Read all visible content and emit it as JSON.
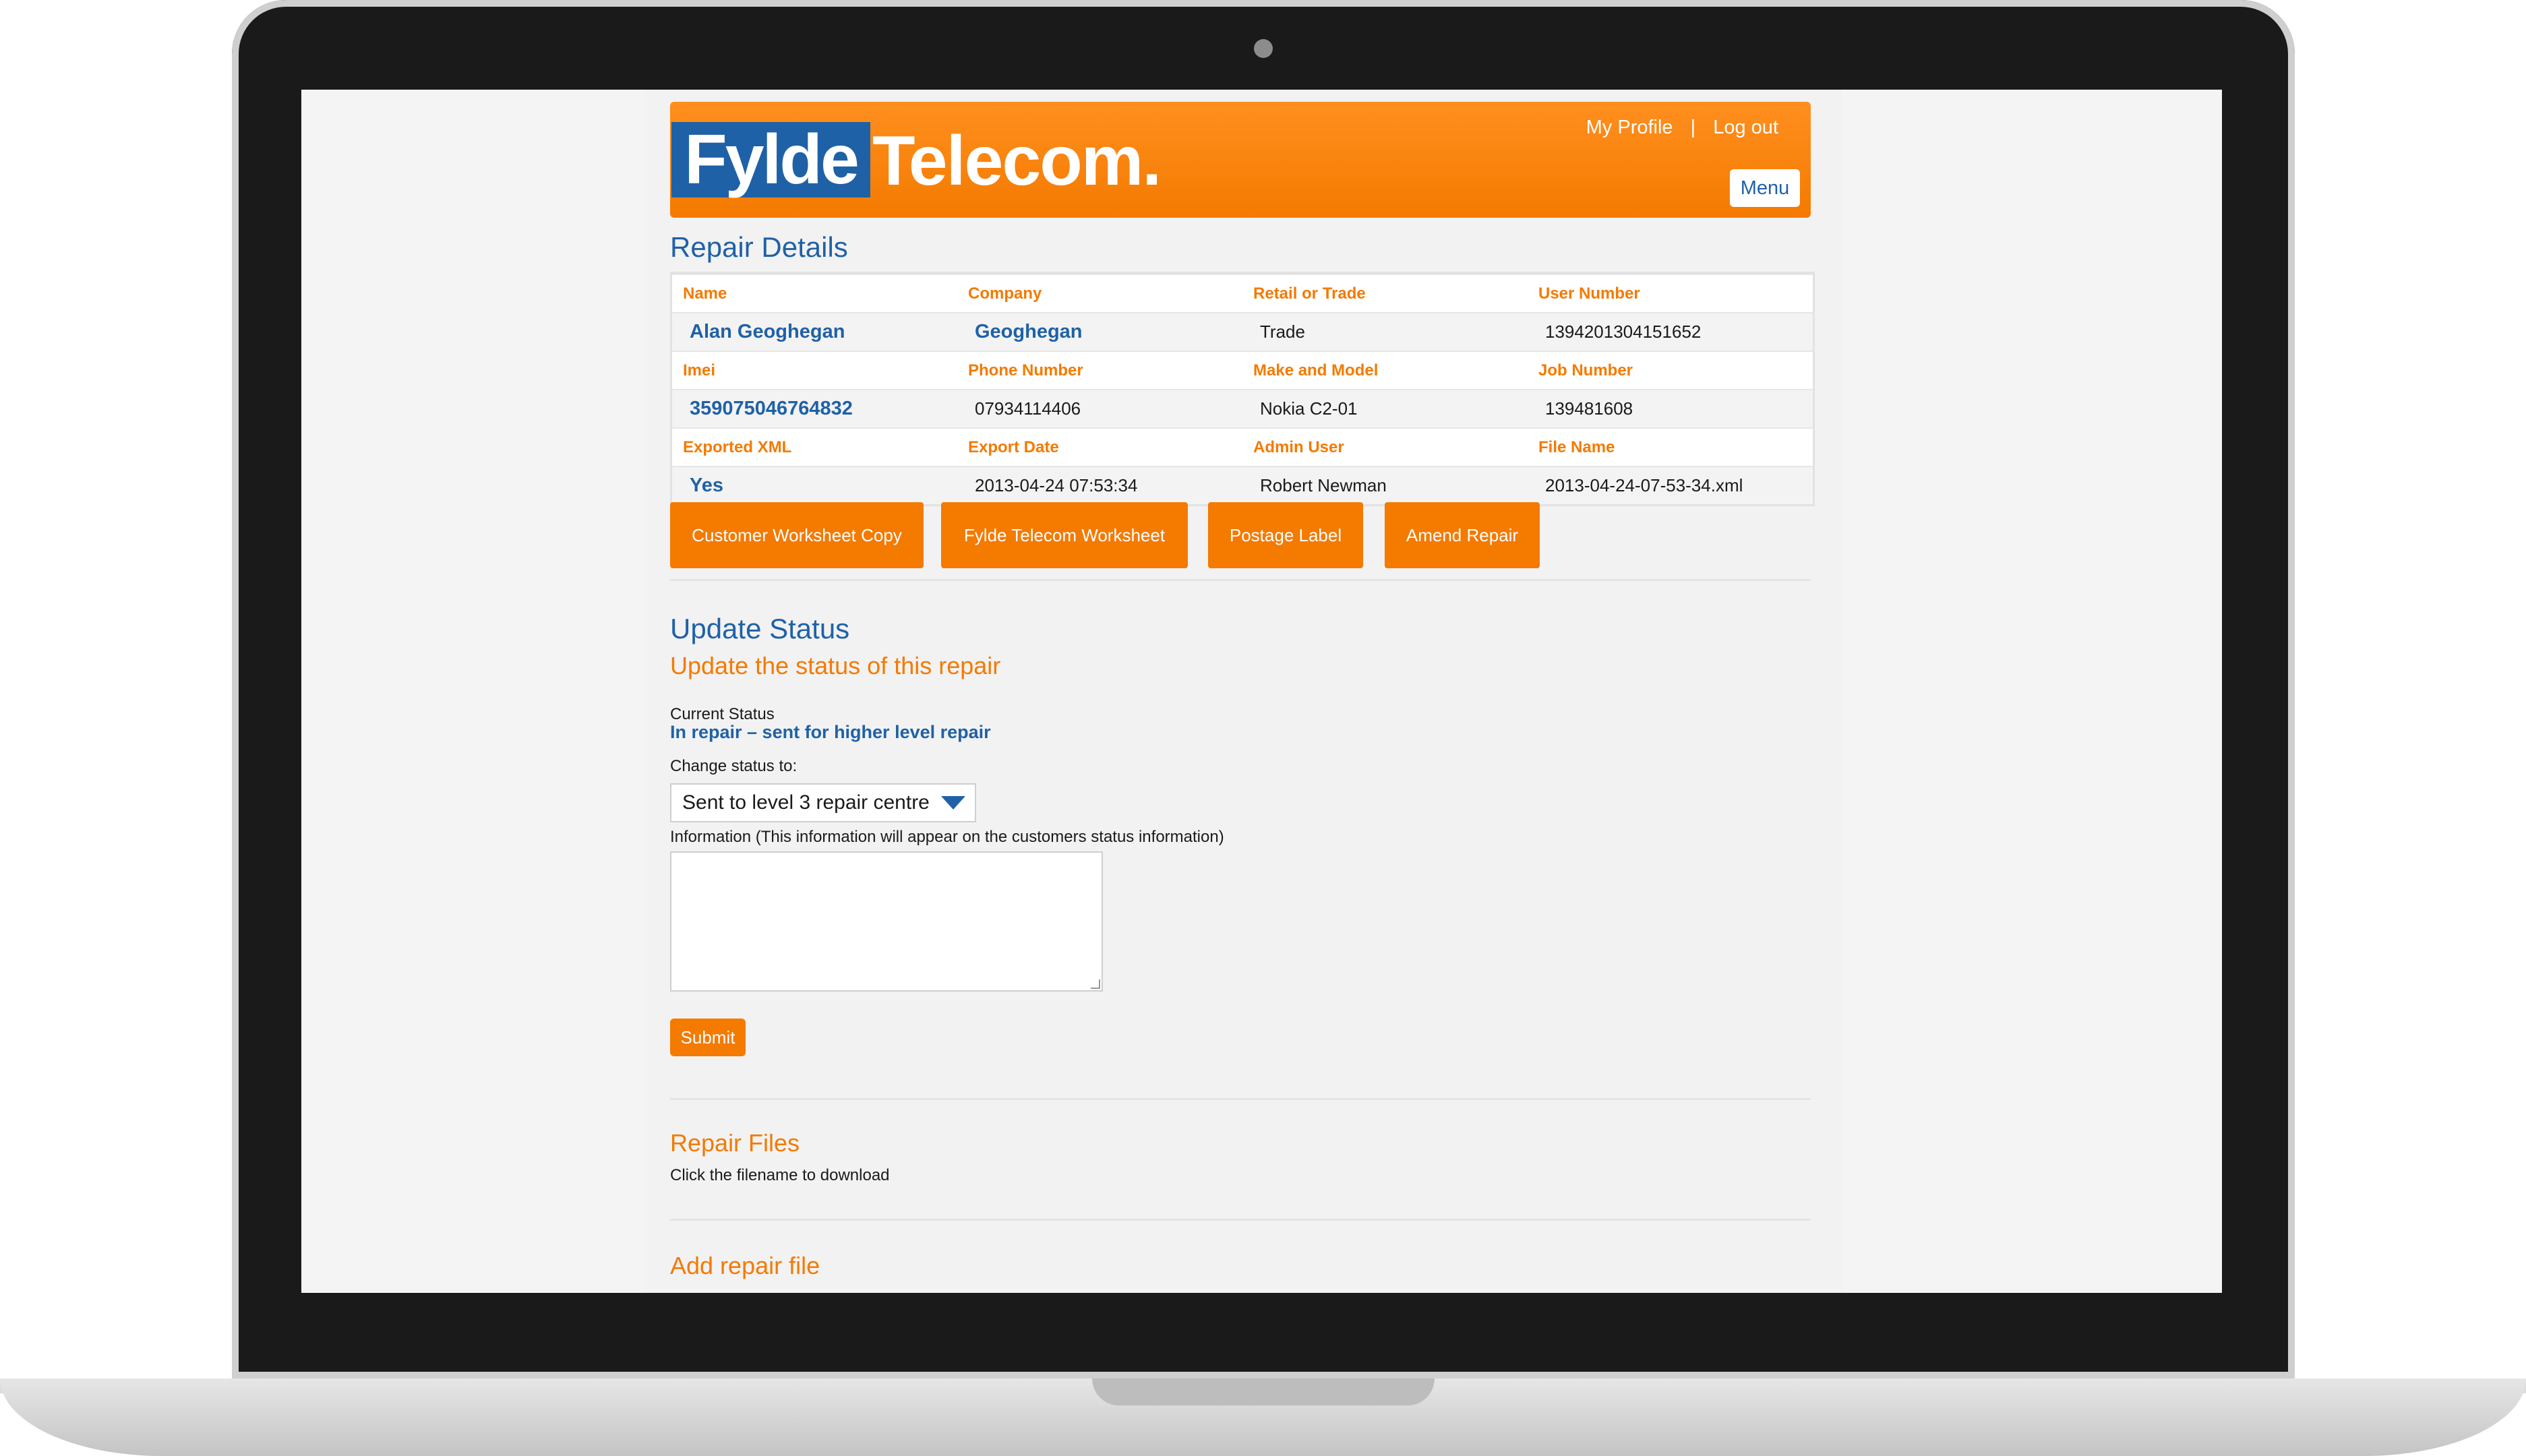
{
  "header": {
    "logo_left": "Fylde",
    "logo_right": "Telecom.",
    "my_profile": "My Profile",
    "separator": "|",
    "log_out": "Log out",
    "menu": "Menu"
  },
  "repair_details": {
    "title": "Repair Details",
    "rows": [
      {
        "labels": [
          "Name",
          "Company",
          "Retail or Trade",
          "User Number"
        ],
        "values": [
          "Alan Geoghegan",
          "Geoghegan",
          "Trade",
          "1394201304151652"
        ]
      },
      {
        "labels": [
          "Imei",
          "Phone Number",
          "Make and Model",
          "Job Number"
        ],
        "values": [
          "359075046764832",
          "07934114406",
          "Nokia C2-01",
          "139481608"
        ]
      },
      {
        "labels": [
          "Exported XML",
          "Export Date",
          "Admin User",
          "File Name"
        ],
        "values": [
          "Yes",
          "2013-04-24 07:53:34",
          "Robert Newman",
          "2013-04-24-07-53-34.xml"
        ]
      }
    ]
  },
  "actions": {
    "customer_worksheet": "Customer Worksheet Copy",
    "fylde_worksheet": "Fylde Telecom Worksheet",
    "postage_label": "Postage Label",
    "amend_repair": "Amend Repair"
  },
  "update_status": {
    "title": "Update Status",
    "subtitle": "Update the status of this repair",
    "current_label": "Current Status",
    "current_value": "In repair – sent for higher level repair",
    "change_label": "Change status to:",
    "selected_option": "Sent to level 3 repair centre",
    "info_label": "Information (This information will appear on the customers status information)",
    "info_value": "",
    "submit": "Submit"
  },
  "repair_files": {
    "title": "Repair Files",
    "hint": "Click the filename to download"
  },
  "add_repair_file": {
    "title": "Add repair file"
  },
  "colors": {
    "orange": "#f47a00",
    "blue": "#1f61a7"
  }
}
